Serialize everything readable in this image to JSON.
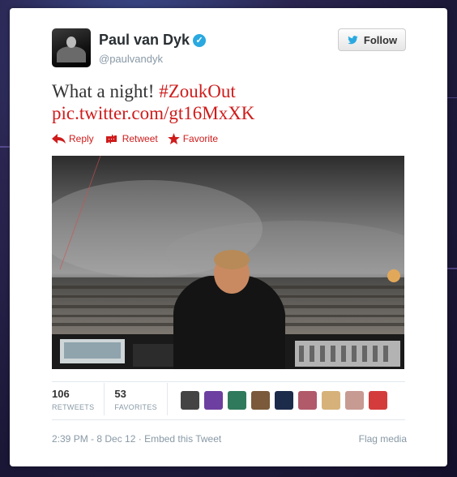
{
  "user": {
    "display_name": "Paul van Dyk",
    "handle": "@paulvandyk",
    "verified_icon": "verified-check-icon"
  },
  "follow_label": "Follow",
  "tweet": {
    "text": "What a night! ",
    "hashtag": "#ZoukOut",
    "pic_link": "pic.twitter.com/gt16MxXK"
  },
  "actions": {
    "reply": "Reply",
    "retweet": "Retweet",
    "favorite": "Favorite"
  },
  "stats": {
    "retweets_count": "106",
    "retweets_label": "RETWEETS",
    "favorites_count": "53",
    "favorites_label": "FAVORITES"
  },
  "favoriters": [
    "#444444",
    "#6d3fa0",
    "#2f7a5c",
    "#7a5a3a",
    "#1d2b4a",
    "#b05a6a",
    "#d6b27a",
    "#c79a92",
    "#d43c3c"
  ],
  "footer": {
    "timestamp": "2:39 PM - 8 Dec 12",
    "separator": " · ",
    "embed": "Embed this Tweet",
    "flag": "Flag media"
  },
  "colors": {
    "link": "#cf1b1b",
    "verified": "#2aa9e0"
  }
}
